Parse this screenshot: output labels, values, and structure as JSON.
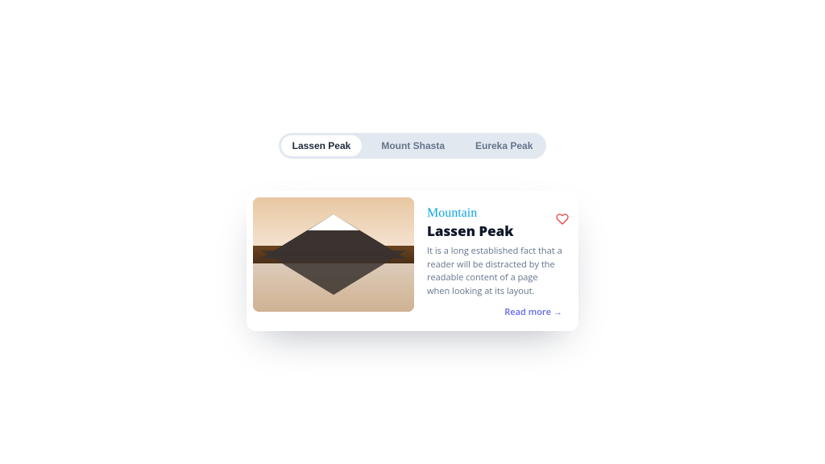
{
  "tabs": {
    "items": [
      {
        "label": "Lassen Peak",
        "active": true
      },
      {
        "label": "Mount Shasta",
        "active": false
      },
      {
        "label": "Eureka Peak",
        "active": false
      }
    ]
  },
  "card": {
    "category": "Mountain",
    "title": "Lassen Peak",
    "description": "It is a long established fact that a reader will be distracted by the readable content of a page when looking at its layout.",
    "read_more_label": "Read more",
    "read_more_arrow": "→",
    "heart_color": "#ef4444"
  }
}
